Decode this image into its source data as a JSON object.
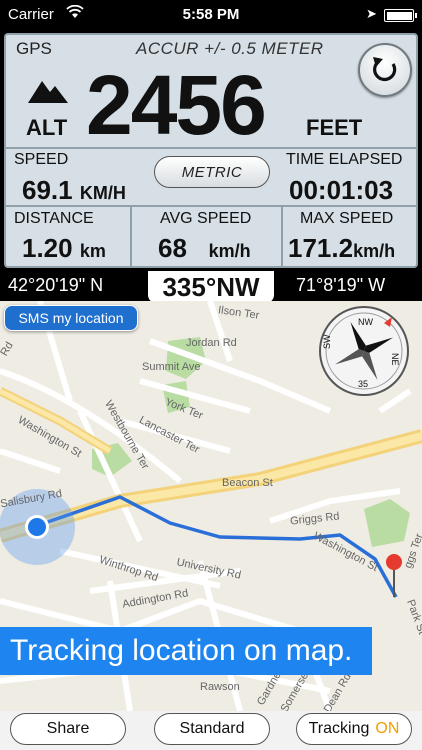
{
  "status_bar": {
    "carrier": "Carrier",
    "time": "5:58 PM"
  },
  "dashboard": {
    "gps_label": "GPS",
    "accuracy": "ACCUR +/- 0.5 METER",
    "alt_label": "ALT",
    "altitude": "2456",
    "alt_unit": "FEET",
    "speed": {
      "label": "SPEED",
      "value": "69.1",
      "unit": "KM/H"
    },
    "metric_button": "METRIC",
    "time_elapsed": {
      "label": "TIME ELAPSED",
      "value": "00:01:03"
    },
    "distance": {
      "label": "DISTANCE",
      "value": "1.20",
      "unit": "km"
    },
    "avg_speed": {
      "label": "AVG SPEED",
      "value": "68",
      "unit": "km/h"
    },
    "max_speed": {
      "label": "MAX SPEED",
      "value": "171.2",
      "unit": "km/h"
    }
  },
  "heading_bar": {
    "latitude": "42°20'19\" N",
    "heading": "335°NW",
    "longitude": "71°8'19\" W"
  },
  "map": {
    "sms_button": "SMS my location",
    "street_labels": [
      "Jordan Rd",
      "Summit Ave",
      "York Ter",
      "Lancaster Ter",
      "Westbourne Ter",
      "Washington St",
      "Beacon St",
      "Griggs Rd",
      "Washington St",
      "University Rd",
      "Winthrop Rd",
      "Addington Rd",
      "Salisbury Rd",
      "Park St",
      "Rawson",
      "Gardner",
      "Somerset",
      "Dean Rd",
      "Ilson Ter",
      "Rd",
      "ggs Ter"
    ],
    "compass_labels": [
      "NW",
      "NE",
      "SW",
      "35"
    ],
    "tracking_banner": "Tracking location on map."
  },
  "toolbar": {
    "share": "Share",
    "standard": "Standard",
    "tracking": "Tracking",
    "tracking_state": "ON"
  },
  "colors": {
    "panel_bg": "#d6dfe5",
    "accent_blue": "#1d84f0",
    "route_blue": "#2a6fd8",
    "on_orange": "#f0a000"
  }
}
